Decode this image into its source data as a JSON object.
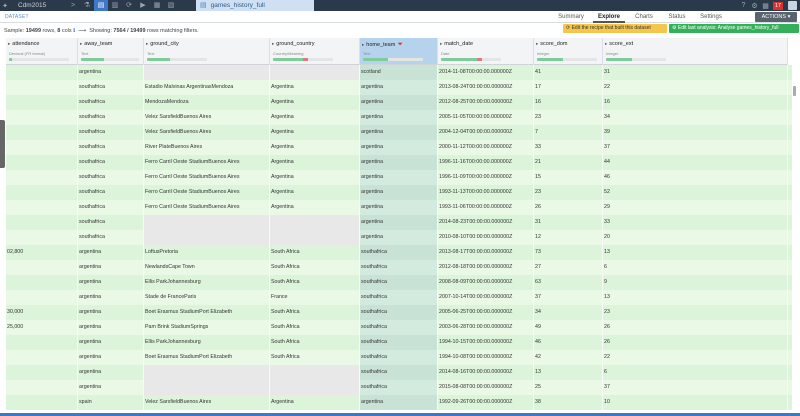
{
  "topbar": {
    "project": "Cdm2015",
    "dataset_name": "games_history_full",
    "notification_count": "17",
    "icons": [
      "flow-icon",
      "lab-icon",
      "dataset-icon",
      "code-icon",
      "recipe-icon",
      "run-icon",
      "notebook-icon",
      "dashboard-icon"
    ]
  },
  "breadcrumb": "DATASET",
  "tabs": [
    "Summary",
    "Explore",
    "Charts",
    "Status",
    "Settings"
  ],
  "active_tab": "Explore",
  "actions_label": "ACTIONS ▾",
  "info": {
    "sample_prefix": "Sample:",
    "rows_count": "19499",
    "rows_label": "rows,",
    "cols_count": "8",
    "cols_label": "cols",
    "showing_prefix": "Showing:",
    "showing_value": "7564 / 19499",
    "showing_suffix": "rows matching filters."
  },
  "buttons": {
    "recipe": "Edit the recipe that built this dataset",
    "edit_analysis": "Edit last analysis: Analyse games_history_full"
  },
  "columns": [
    {
      "name": "attendance",
      "type": "Decimal (FR format)",
      "valid": 0.05,
      "invalid": 0.0
    },
    {
      "name": "away_team",
      "type": "Text",
      "valid": 0.4,
      "invalid": 0.0
    },
    {
      "name": "ground_city",
      "type": "Text",
      "valid": 0.38,
      "invalid": 0.0
    },
    {
      "name": "ground_country",
      "type": "Country/Meaning",
      "valid": 0.5,
      "invalid": 0.08
    },
    {
      "name": "home_team",
      "type": "Text",
      "valid": 0.42,
      "invalid": 0.0
    },
    {
      "name": "match_date",
      "type": "Date",
      "valid": 0.6,
      "invalid": 0.08
    },
    {
      "name": "score_dom",
      "type": "Integer",
      "valid": 0.44,
      "invalid": 0.0
    },
    {
      "name": "score_ext",
      "type": "Integer",
      "valid": 0.44,
      "invalid": 0.0
    }
  ],
  "rows": [
    [
      "",
      "argentina",
      "",
      "",
      "scotland",
      "2014-11-08T00:00:00.000000Z",
      "41",
      "31"
    ],
    [
      "",
      "southafrica",
      "Estadio Malvinas ArgentinasMendoza",
      "Argentina",
      "argentina",
      "2013-08-24T00:00:00.000000Z",
      "17",
      "22"
    ],
    [
      "",
      "southafrica",
      "MendozaMendoza",
      "Argentina",
      "argentina",
      "2012-08-25T00:00:00.000000Z",
      "16",
      "16"
    ],
    [
      "",
      "southafrica",
      "Velez SarsfieldBuenos Aires",
      "Argentina",
      "argentina",
      "2005-11-05T00:00:00.000000Z",
      "23",
      "34"
    ],
    [
      "",
      "southafrica",
      "Velez SarsfieldBuenos Aires",
      "Argentina",
      "argentina",
      "2004-12-04T00:00:00.000000Z",
      "7",
      "39"
    ],
    [
      "",
      "southafrica",
      "River PlateBuenos Aires",
      "Argentina",
      "argentina",
      "2000-11-12T00:00:00.000000Z",
      "33",
      "37"
    ],
    [
      "",
      "southafrica",
      "Ferro Carril Oeste StadiumBuenos Aires",
      "Argentina",
      "argentina",
      "1996-11-16T00:00:00.000000Z",
      "21",
      "44"
    ],
    [
      "",
      "southafrica",
      "Ferro Carril Oeste StadiumBuenos Aires",
      "Argentina",
      "argentina",
      "1996-11-09T00:00:00.000000Z",
      "15",
      "46"
    ],
    [
      "",
      "southafrica",
      "Ferro Carril Oeste StadiumBuenos Aires",
      "Argentina",
      "argentina",
      "1993-11-13T00:00:00.000000Z",
      "23",
      "52"
    ],
    [
      "",
      "southafrica",
      "Ferro Carril Oeste StadiumBuenos Aires",
      "Argentina",
      "argentina",
      "1993-11-06T00:00:00.000000Z",
      "26",
      "29"
    ],
    [
      "",
      "southafrica",
      "",
      "",
      "argentina",
      "2014-08-23T00:00:00.000000Z",
      "31",
      "33"
    ],
    [
      "",
      "southafrica",
      "",
      "",
      "argentina",
      "2010-08-10T00:00:00.000000Z",
      "12",
      "20"
    ],
    [
      "02,800",
      "argentina",
      "LoftusPretoria",
      "South Africa",
      "southafrica",
      "2013-08-17T00:00:00.000000Z",
      "73",
      "13"
    ],
    [
      "",
      "argentina",
      "NewlandsCape Town",
      "South Africa",
      "southafrica",
      "2012-08-18T00:00:00.000000Z",
      "27",
      "6"
    ],
    [
      "",
      "argentina",
      "Ellis ParkJohannesburg",
      "South Africa",
      "southafrica",
      "2008-08-09T00:00:00.000000Z",
      "63",
      "9"
    ],
    [
      "",
      "argentina",
      "Stade de FranceParis",
      "France",
      "southafrica",
      "2007-10-14T00:00:00.000000Z",
      "37",
      "13"
    ],
    [
      "30,000",
      "argentina",
      "Boet Erasmus StadiumPort Elizabeth",
      "South Africa",
      "southafrica",
      "2005-06-25T00:00:00.000000Z",
      "34",
      "23"
    ],
    [
      "25,000",
      "argentina",
      "Pam Brink StadiumSprings",
      "South Africa",
      "southafrica",
      "2003-06-28T00:00:00.000000Z",
      "49",
      "26"
    ],
    [
      "",
      "argentina",
      "Ellis ParkJohannesburg",
      "South Africa",
      "southafrica",
      "1994-10-15T00:00:00.000000Z",
      "46",
      "26"
    ],
    [
      "",
      "argentina",
      "Boet Erasmus StadiumPort Elizabeth",
      "South Africa",
      "southafrica",
      "1994-10-08T00:00:00.000000Z",
      "42",
      "22"
    ],
    [
      "",
      "argentina",
      "",
      "",
      "southafrica",
      "2014-08-16T00:00:00.000000Z",
      "13",
      "6"
    ],
    [
      "",
      "argentina",
      "",
      "",
      "southafrica",
      "2015-08-08T00:00:00.000000Z",
      "25",
      "37"
    ],
    [
      "",
      "spain",
      "Velez SarsfieldBuenos Aires",
      "Argentina",
      "argentina",
      "1992-09-26T00:00:00.000000Z",
      "38",
      "10"
    ]
  ]
}
